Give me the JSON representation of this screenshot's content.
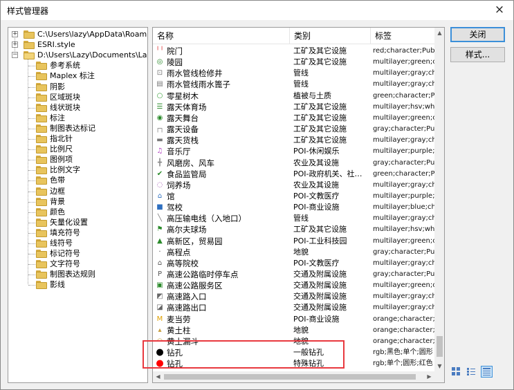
{
  "window": {
    "title": "样式管理器",
    "close_glyph": "×"
  },
  "tree": {
    "roots": [
      {
        "label": "C:\\Users\\lazy\\AppData\\Roaming\\E",
        "expander": "+"
      },
      {
        "label": "ESRI.style",
        "expander": "+"
      },
      {
        "label": "D:\\Users\\Lazy\\Documents\\Lazysh",
        "expander": "−"
      }
    ],
    "children": [
      "参考系统",
      "Maplex 标注",
      "阴影",
      "区域斑块",
      "线状斑块",
      "标注",
      "制图表达标记",
      "指北针",
      "比例尺",
      "图例项",
      "比例文字",
      "色带",
      "边框",
      "背景",
      "颜色",
      "矢量化设置",
      "填充符号",
      "线符号",
      "标记符号",
      "文字符号",
      "制图表达规则",
      "影线"
    ]
  },
  "list": {
    "columns": [
      "名称",
      "类别",
      "标签"
    ],
    "rows": [
      {
        "icon": "gate-icon",
        "glyph": "╵╵",
        "color": "#d33",
        "name": "院门",
        "category": "工矿及其它设施",
        "tags": "red;character;Public"
      },
      {
        "icon": "cemetery-icon",
        "glyph": "◎",
        "color": "#2a8a2a",
        "name": "陵园",
        "category": "工矿及其它设施",
        "tags": "multilayer;green;cha"
      },
      {
        "icon": "manhole-icon",
        "glyph": "⊡",
        "color": "#777",
        "name": "雨水管线检修井",
        "category": "管线",
        "tags": "multilayer;gray;chara"
      },
      {
        "icon": "grate-icon",
        "glyph": "▤",
        "color": "#777",
        "name": "雨水管线雨水篦子",
        "category": "管线",
        "tags": "multilayer;gray;chara"
      },
      {
        "icon": "tree-icon",
        "glyph": "○",
        "color": "#3aa03a",
        "name": "零星树木",
        "category": "植被与土质",
        "tags": "green;character;Pul"
      },
      {
        "icon": "stadium-icon",
        "glyph": "☰",
        "color": "#2a8a2a",
        "name": "露天体育场",
        "category": "工矿及其它设施",
        "tags": "multilayer;hsv;white"
      },
      {
        "icon": "stage-icon",
        "glyph": "◉",
        "color": "#2a8a2a",
        "name": "露天舞台",
        "category": "工矿及其它设施",
        "tags": "multilayer;green;cha"
      },
      {
        "icon": "equipment-icon",
        "glyph": "┌┐",
        "color": "#888",
        "name": "露天设备",
        "category": "工矿及其它设施",
        "tags": "gray;character;Publ"
      },
      {
        "icon": "cargo-icon",
        "glyph": "▬",
        "color": "#777",
        "name": "露天货栈",
        "category": "工矿及其它设施",
        "tags": "multilayer;gray;chara"
      },
      {
        "icon": "music-icon",
        "glyph": "♫",
        "color": "#b03cc0",
        "name": "音乐厅",
        "category": "POI-休闲娱乐",
        "tags": "multilayer;purple;pin"
      },
      {
        "icon": "windmill-icon",
        "glyph": "╋",
        "color": "#888",
        "name": "风磨房、风车",
        "category": "农业及其设施",
        "tags": "gray;character;Publ"
      },
      {
        "icon": "food-icon",
        "glyph": "✔",
        "color": "#2a8a2a",
        "name": "食品监管局",
        "category": "POI-政府机关、社…",
        "tags": "green;character;Pul"
      },
      {
        "icon": "farm-icon",
        "glyph": "◌",
        "color": "#a050b0",
        "name": "饲养场",
        "category": "农业及其设施",
        "tags": "multilayer;gray;chara"
      },
      {
        "icon": "museum-icon",
        "glyph": "⌂",
        "color": "#2e6fc0",
        "name": "馆",
        "category": "POI-文教医疗",
        "tags": "multilayer;purple;pin"
      },
      {
        "icon": "driving-icon",
        "glyph": "■",
        "color": "#2e6fc0",
        "name": "驾校",
        "category": "POI-商业设施",
        "tags": "multilayer;blue;chara"
      },
      {
        "icon": "pipe-icon",
        "glyph": "╲",
        "color": "#777",
        "name": "高压输电线（入地口）",
        "category": "管线",
        "tags": "multilayer;gray;chara"
      },
      {
        "icon": "golf-icon",
        "glyph": "⚑",
        "color": "#2a8a2a",
        "name": "高尔夫球场",
        "category": "工矿及其它设施",
        "tags": "multilayer;hsv;white"
      },
      {
        "icon": "industry-icon",
        "glyph": "▲",
        "color": "#2a8a2a",
        "name": "高新区，贸易园",
        "category": "POI-工业科技园",
        "tags": "multilayer;green;cha"
      },
      {
        "icon": "elevation-icon",
        "glyph": "·",
        "color": "#444",
        "name": "高程点",
        "category": "地貌",
        "tags": "gray;character;Publ"
      },
      {
        "icon": "school-icon",
        "glyph": "⌂",
        "color": "#555",
        "name": "高等院校",
        "category": "POI-文教医疗",
        "tags": "multilayer;gray;chara"
      },
      {
        "icon": "parking-icon",
        "glyph": "P",
        "color": "#555",
        "name": "高速公路临时停车点",
        "category": "交通及附属设施",
        "tags": "gray;character;Publ"
      },
      {
        "icon": "service-icon",
        "glyph": "▣",
        "color": "#2a8a2a",
        "name": "高速公路服务区",
        "category": "交通及附属设施",
        "tags": "multilayer;green;cha"
      },
      {
        "icon": "entrance-icon",
        "glyph": "◩",
        "color": "#666",
        "name": "高速路入口",
        "category": "交通及附属设施",
        "tags": "multilayer;gray;chara"
      },
      {
        "icon": "exit-icon",
        "glyph": "◪",
        "color": "#666",
        "name": "高速路出口",
        "category": "交通及附属设施",
        "tags": "multilayer;gray;chara"
      },
      {
        "icon": "mcdonalds-icon",
        "glyph": "M",
        "color": "#e0a000",
        "name": "麦当劳",
        "category": "POI-商业设施",
        "tags": "orange;character;Pu"
      },
      {
        "icon": "earth-pillar-icon",
        "glyph": "▴",
        "color": "#c8a040",
        "name": "黄土柱",
        "category": "地貌",
        "tags": "orange;character;Pu"
      },
      {
        "icon": "earth-mound-icon",
        "glyph": "◠",
        "color": "#c8a040",
        "name": "黄土漏斗",
        "category": "地貌",
        "tags": "orange;character;Pu"
      },
      {
        "icon": "drill-black-icon",
        "glyph": "●",
        "color": "#000000",
        "name": "钻孔",
        "category": "一般钻孔",
        "tags": "rgb;黑色;单个;圆形"
      },
      {
        "icon": "drill-red-icon",
        "glyph": "●",
        "color": "#ff0000",
        "name": "钻孔",
        "category": "特殊钻孔",
        "tags": "rgb;单个;圆形;红色"
      }
    ]
  },
  "buttons": {
    "close": "关闭",
    "styles": "样式..."
  },
  "highlight_color": "#e8383e"
}
